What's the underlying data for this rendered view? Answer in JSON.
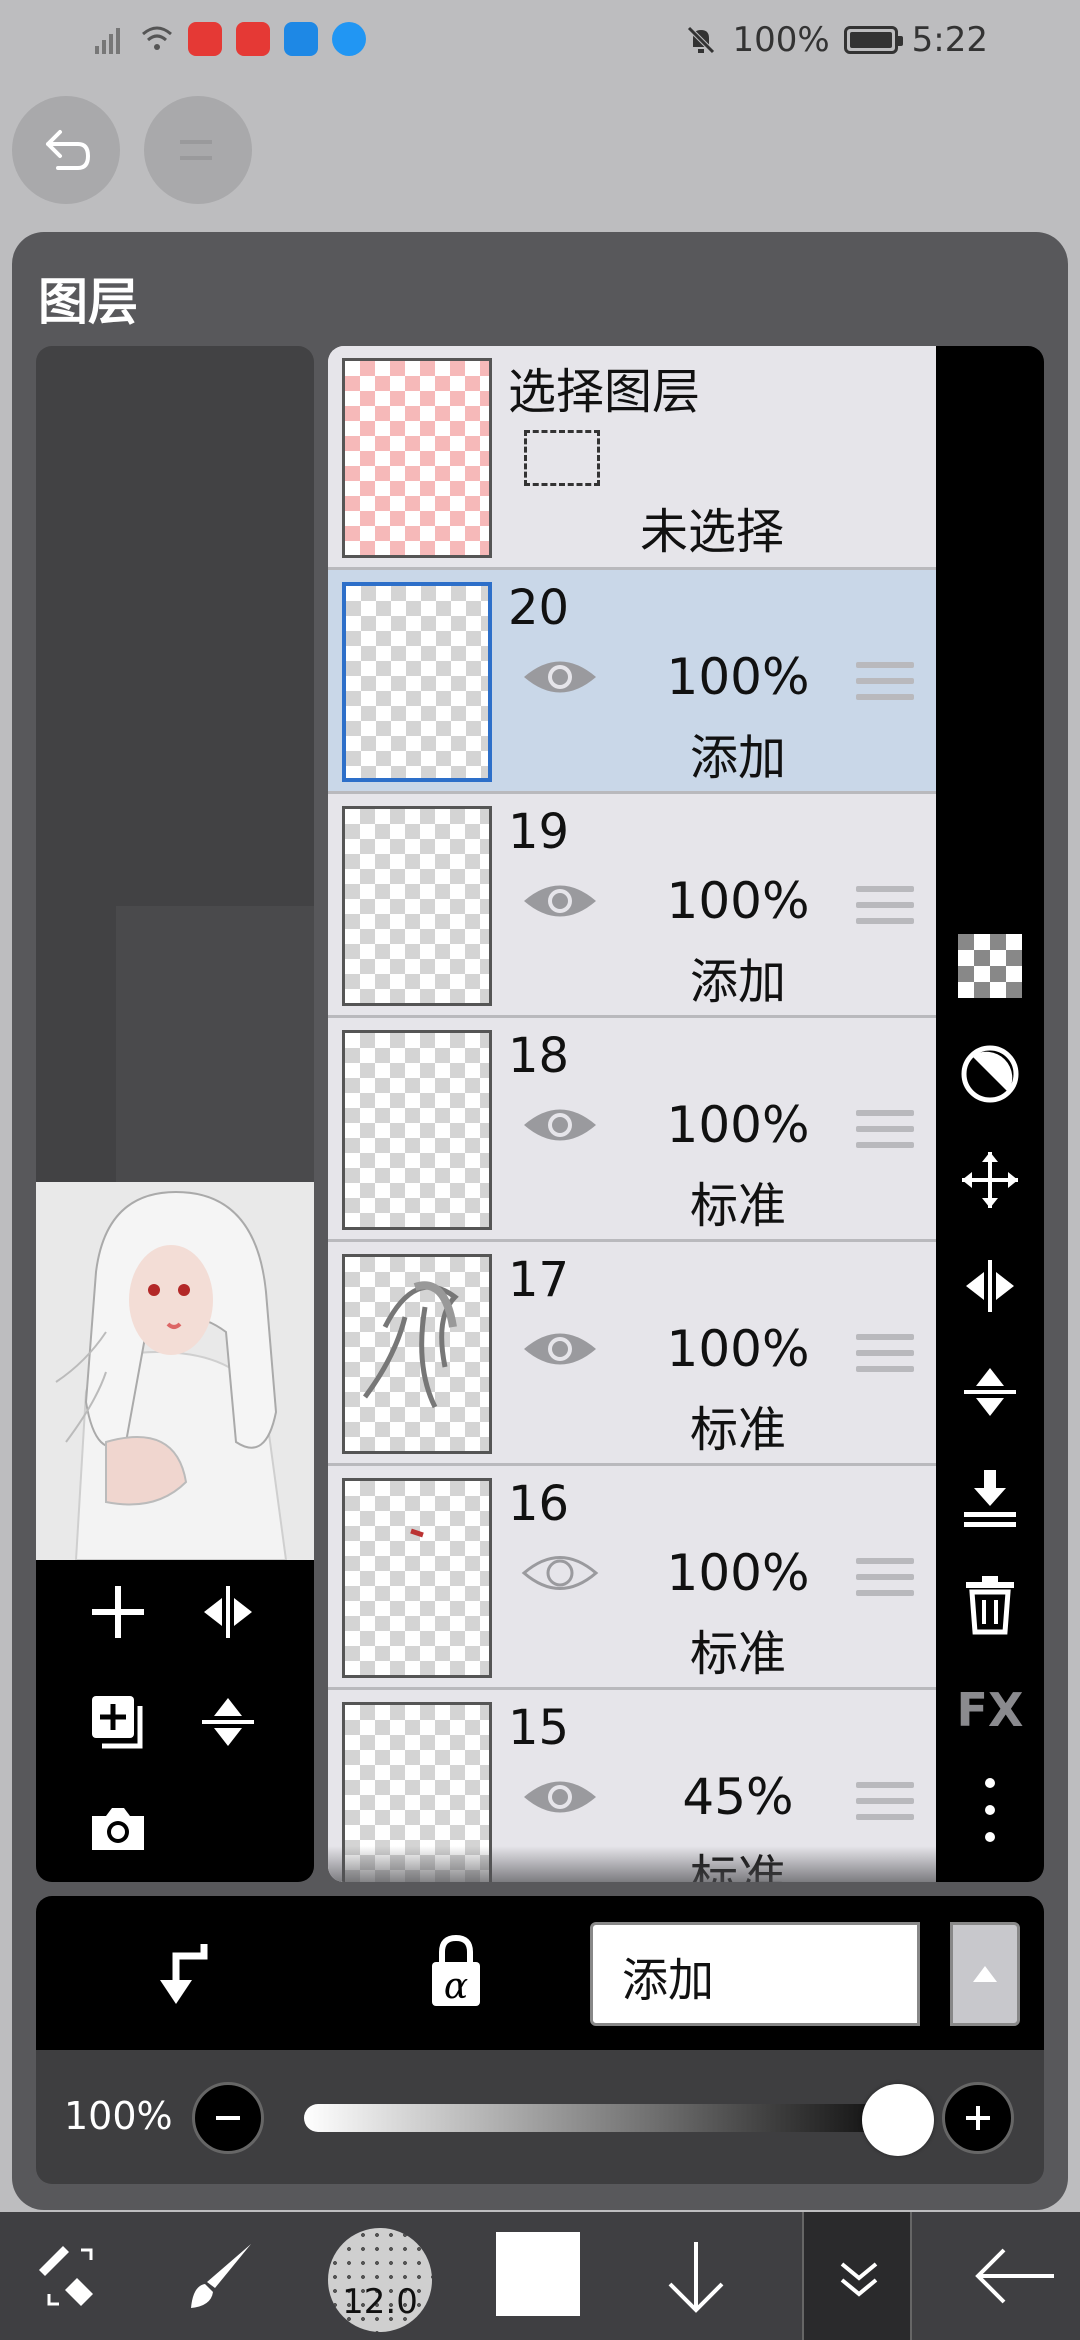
{
  "status_bar": {
    "battery_text": "100%",
    "time": "5:22",
    "app_icons": [
      "huawei-app-icon",
      "huawei-app-icon",
      "weather-icon",
      "browser-icon"
    ]
  },
  "panel": {
    "title": "图层"
  },
  "selection_layer": {
    "title": "选择图层",
    "status": "未选择"
  },
  "layers": [
    {
      "number": "20",
      "opacity": "100%",
      "mode": "添加",
      "visible": true,
      "selected": true
    },
    {
      "number": "19",
      "opacity": "100%",
      "mode": "添加",
      "visible": true,
      "selected": false
    },
    {
      "number": "18",
      "opacity": "100%",
      "mode": "标准",
      "visible": true,
      "selected": false
    },
    {
      "number": "17",
      "opacity": "100%",
      "mode": "标准",
      "visible": true,
      "selected": false
    },
    {
      "number": "16",
      "opacity": "100%",
      "mode": "标准",
      "visible": false,
      "selected": false
    },
    {
      "number": "15",
      "opacity": "45%",
      "mode": "标准",
      "visible": true,
      "selected": false
    }
  ],
  "right_tools": {
    "fx_label": "FX"
  },
  "blend": {
    "selected_mode": "添加"
  },
  "opacity": {
    "label": "100%",
    "value": 1.0
  },
  "toolbar": {
    "brush_size": "12.0"
  },
  "colors": {
    "accent": "#2d6fc9",
    "selected_row": "#c9d7e8",
    "panel_bg": "#58585b"
  }
}
